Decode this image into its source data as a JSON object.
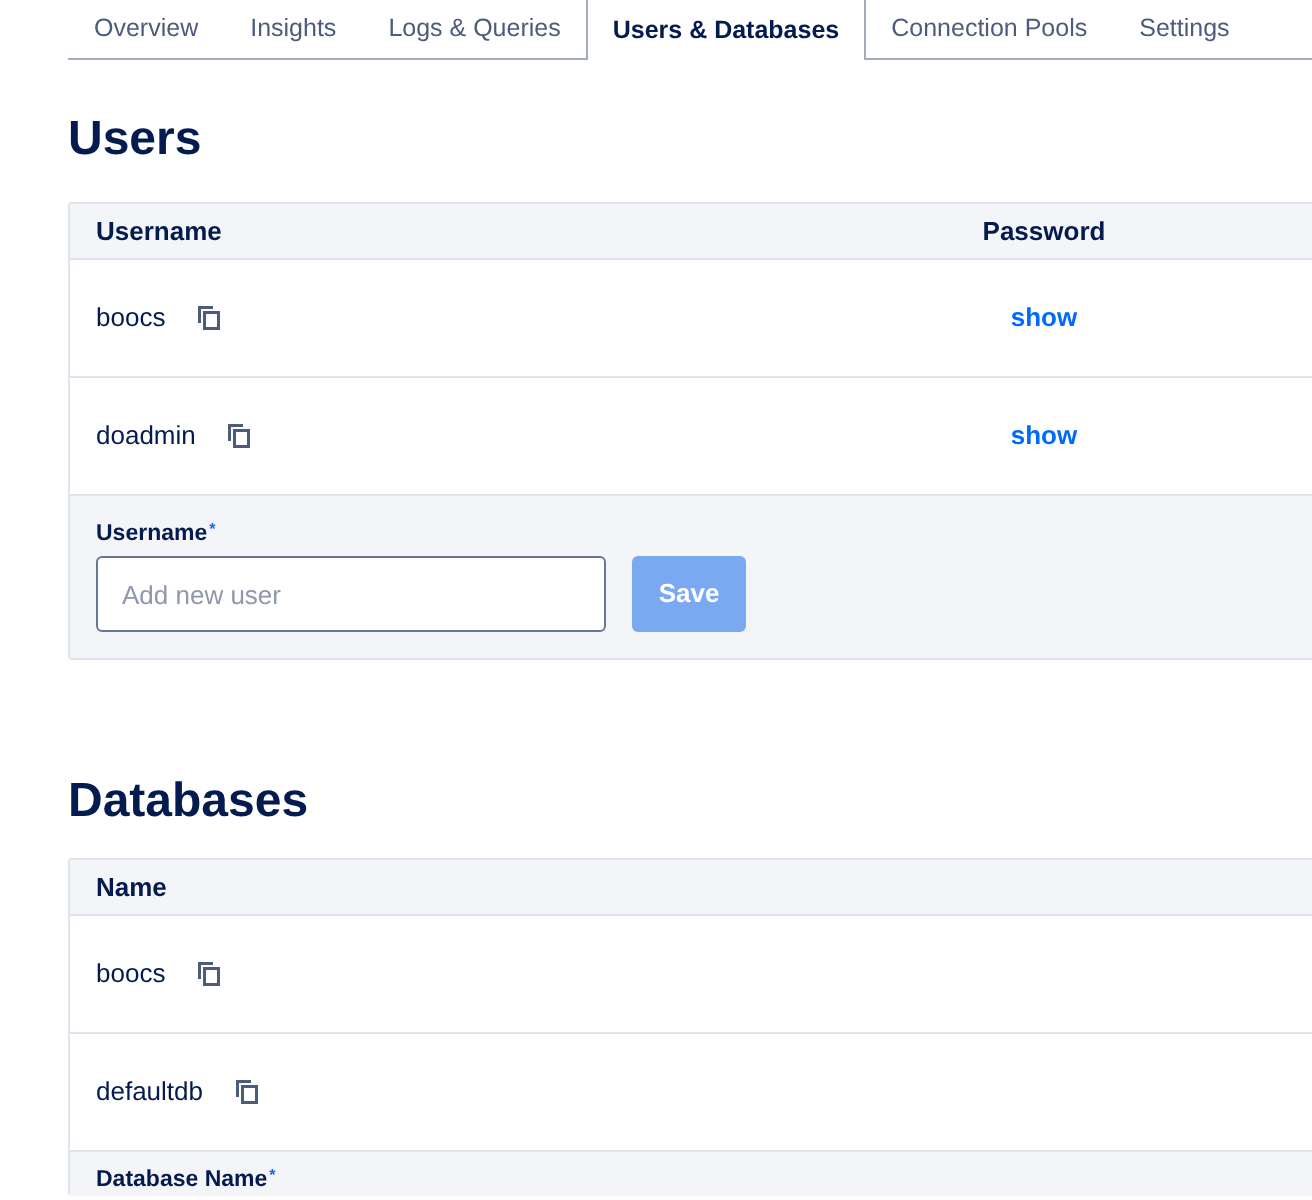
{
  "tabs": [
    {
      "label": "Overview",
      "selected": false
    },
    {
      "label": "Insights",
      "selected": false
    },
    {
      "label": "Logs & Queries",
      "selected": false
    },
    {
      "label": "Users & Databases",
      "selected": true
    },
    {
      "label": "Connection Pools",
      "selected": false
    },
    {
      "label": "Settings",
      "selected": false
    }
  ],
  "users": {
    "title": "Users",
    "columns": [
      "Username",
      "Password"
    ],
    "rows": [
      {
        "username": "boocs",
        "password_action": "show"
      },
      {
        "username": "doadmin",
        "password_action": "show"
      }
    ],
    "form": {
      "label": "Username",
      "required_mark": "*",
      "placeholder": "Add new user",
      "button": {
        "label": "Save",
        "disabled": true
      }
    }
  },
  "databases": {
    "title": "Databases",
    "columns": [
      "Name"
    ],
    "rows": [
      {
        "name": "boocs"
      },
      {
        "name": "defaultdb"
      }
    ],
    "form": {
      "label": "Database Name",
      "required_mark": "*"
    }
  }
}
